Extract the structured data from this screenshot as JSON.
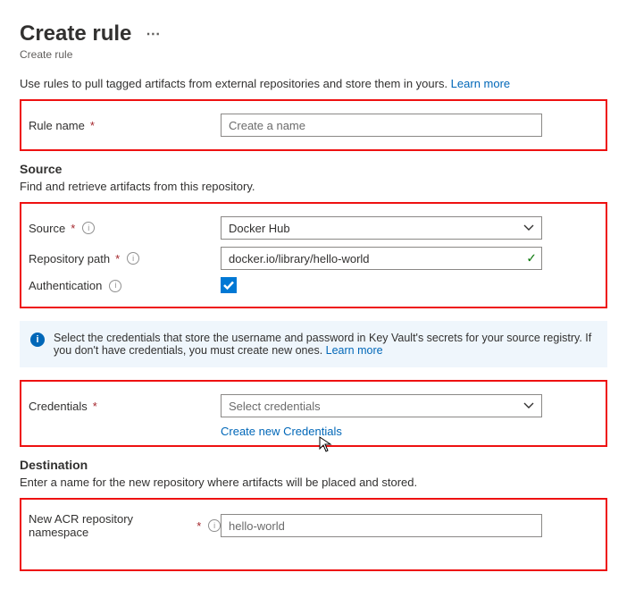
{
  "header": {
    "title": "Create rule",
    "subtitle": "Create rule"
  },
  "intro": {
    "text": "Use rules to pull tagged artifacts from external repositories and store them in yours. ",
    "learn_more": "Learn more"
  },
  "rule_name": {
    "label": "Rule name",
    "placeholder": "Create a name",
    "value": ""
  },
  "source": {
    "heading": "Source",
    "subtext": "Find and retrieve artifacts from this repository.",
    "source_label": "Source",
    "source_value": "Docker Hub",
    "repo_label": "Repository path",
    "repo_value": "docker.io/library/hello-world",
    "auth_label": "Authentication",
    "auth_checked": true
  },
  "info_panel": {
    "text": "Select the credentials that store the username and password in Key Vault's secrets for your source registry. If you don't have credentials, you must create new ones. ",
    "learn_more": "Learn more"
  },
  "credentials": {
    "label": "Credentials",
    "placeholder": "Select credentials",
    "create_link": "Create new Credentials"
  },
  "destination": {
    "heading": "Destination",
    "subtext": "Enter a name for the new repository where artifacts will be placed and stored.",
    "namespace_label": "New ACR repository namespace",
    "namespace_placeholder": "hello-world",
    "namespace_value": ""
  },
  "colors": {
    "link": "#0067b8",
    "highlight_border": "#e11",
    "accent": "#0078d4"
  }
}
